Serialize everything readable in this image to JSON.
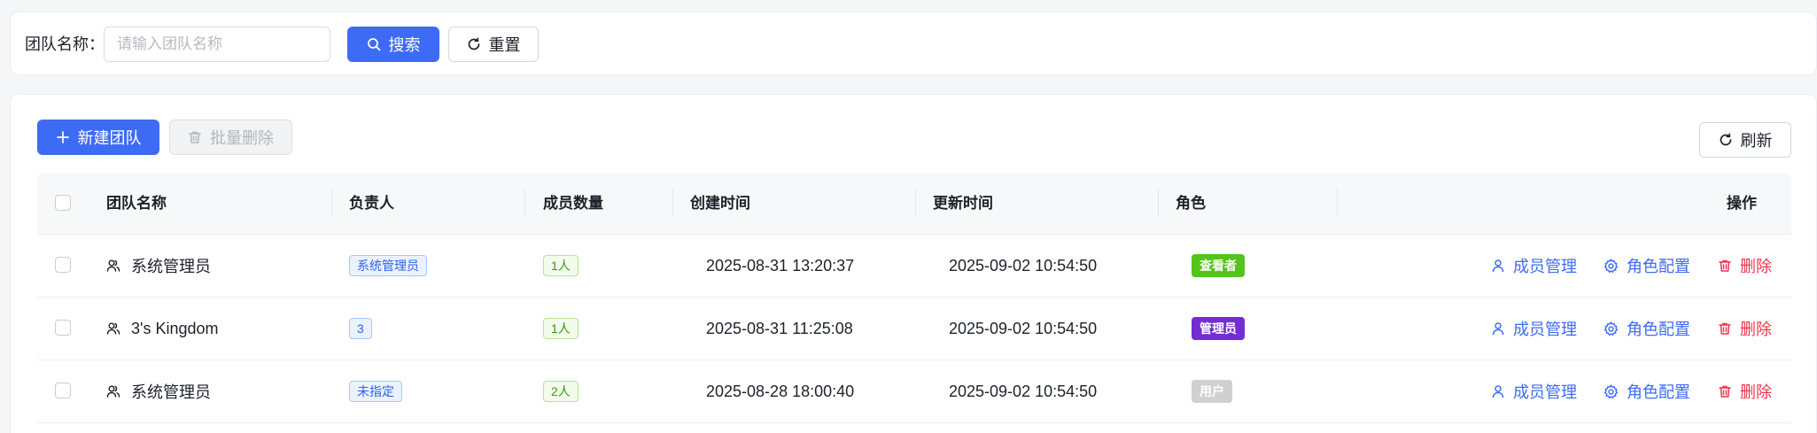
{
  "search": {
    "label": "团队名称：",
    "placeholder": "请输入团队名称",
    "value": "",
    "search_button": "搜索",
    "reset_button": "重置"
  },
  "toolbar": {
    "new_team": "新建团队",
    "batch_delete": "批量删除",
    "refresh": "刷新"
  },
  "table": {
    "columns": [
      "团队名称",
      "负责人",
      "成员数量",
      "创建时间",
      "更新时间",
      "角色",
      "操作"
    ],
    "rows": [
      {
        "name": "系统管理员",
        "owner": "系统管理员",
        "members": "1人",
        "created": "2025-08-31 13:20:37",
        "updated": "2025-09-02 10:54:50",
        "role": "查看者"
      },
      {
        "name": "3's Kingdom",
        "owner": "3",
        "members": "1人",
        "created": "2025-08-31 11:25:08",
        "updated": "2025-09-02 10:54:50",
        "role": "管理员"
      },
      {
        "name": "系统管理员",
        "owner": "未指定",
        "members": "2人",
        "created": "2025-08-28 18:00:40",
        "updated": "2025-09-02 10:54:50",
        "role": "用户"
      }
    ],
    "actions": {
      "members": "成员管理",
      "roles": "角色配置",
      "delete": "删除"
    }
  },
  "colors": {
    "primary": "#3e6bf5",
    "danger": "#f0334a",
    "role_viewer": "#52c41a",
    "role_admin": "#722ed1",
    "role_user": "#d0d0d0"
  }
}
